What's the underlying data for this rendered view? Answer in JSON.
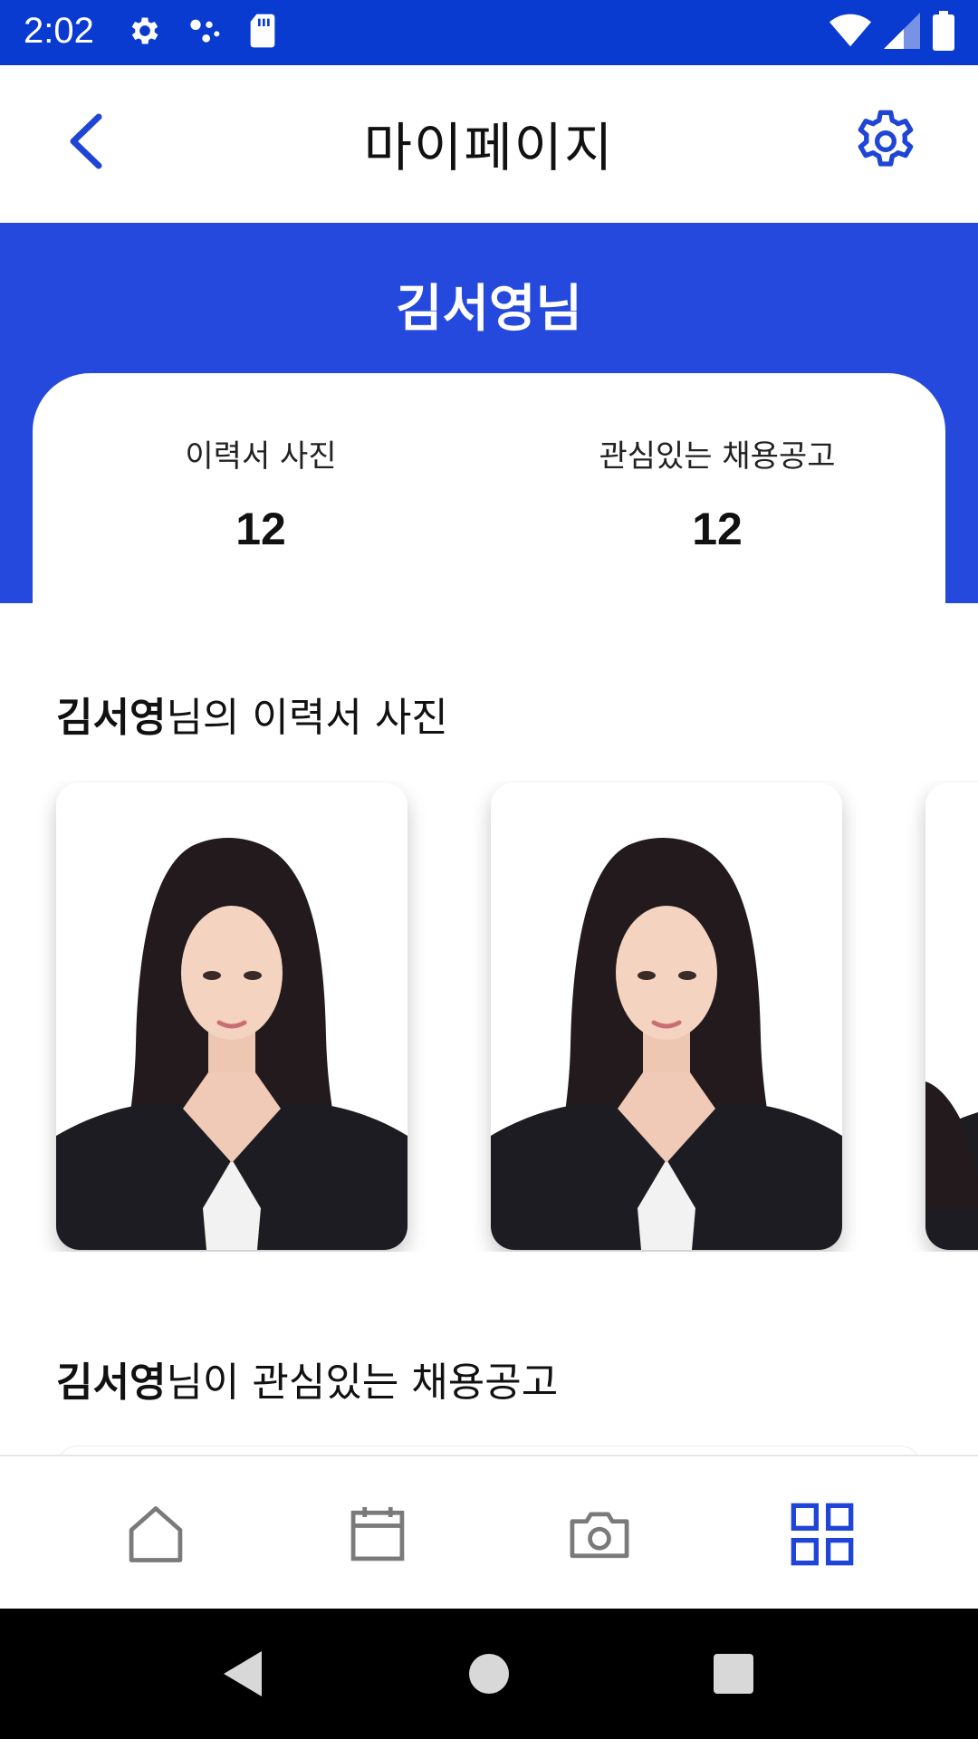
{
  "status_bar": {
    "time": "2:02",
    "left_icons": [
      "settings-gear-icon",
      "assistant-dots-icon",
      "sd-card-icon"
    ],
    "right_icons": [
      "wifi-icon",
      "cellular-signal-icon",
      "battery-icon"
    ]
  },
  "app_bar": {
    "title": "마이페이지",
    "back_icon": "chevron-left-icon",
    "settings_icon": "gear-icon"
  },
  "profile": {
    "name": "김서영님",
    "stats": [
      {
        "label": "이력서 사진",
        "value": "12"
      },
      {
        "label": "관심있는 채용공고",
        "value": "12"
      }
    ]
  },
  "sections": {
    "photos": {
      "name": "김서영",
      "suffix": "님의 이력서 사진"
    },
    "jobs": {
      "name": "김서영",
      "suffix": "님이 관심있는 채용공고"
    }
  },
  "bottom_nav": {
    "items": [
      {
        "icon": "home-icon",
        "active": false
      },
      {
        "icon": "calendar-icon",
        "active": false
      },
      {
        "icon": "camera-icon",
        "active": false
      },
      {
        "icon": "grid-icon",
        "active": true
      }
    ]
  },
  "colors": {
    "status_bar": "#0a3bd1",
    "header": "#2449dc",
    "accent": "#1f45d6",
    "nav_inactive": "#7a7a7a"
  }
}
